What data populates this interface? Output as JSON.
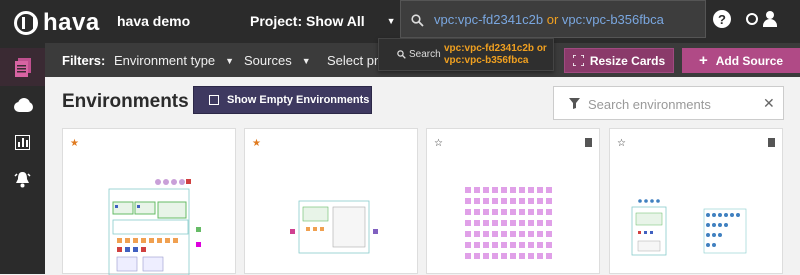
{
  "app": {
    "brand": "hava",
    "workspace": "hava demo",
    "project_label": "Project: Show All",
    "search_query_parts": [
      "vpc:vpc-fd2341c2b",
      " or ",
      "vpc:vpc-b356fbca"
    ],
    "help_label": "?"
  },
  "sidebar": {
    "items": [
      {
        "icon": "documents-icon",
        "active": true
      },
      {
        "icon": "cloud-icon",
        "active": false
      },
      {
        "icon": "bar-chart-icon",
        "active": false
      },
      {
        "icon": "bell-icon",
        "active": false
      }
    ]
  },
  "filters": {
    "label": "Filters:",
    "environment_type": "Environment type",
    "sources": "Sources",
    "select": "Select pro"
  },
  "dropdown": {
    "label": "Search",
    "text": "vpc:vpc-fd2341c2b or vpc:vpc-b356fbca"
  },
  "buttons": {
    "resize": "Resize Cards",
    "add_source": "Add Source",
    "show_empty": "Show Empty Environments"
  },
  "main": {
    "title": "Environments",
    "search_placeholder": "Search environments"
  },
  "colors": {
    "brand_pink": "#b04a86",
    "dark_bg": "#2b2b2b",
    "query_token": "#7aa7e0",
    "query_operator": "#f0a020",
    "purple_button": "#3e3960"
  },
  "cards": [
    {
      "starred": true,
      "deletable": false
    },
    {
      "starred": true,
      "deletable": false
    },
    {
      "starred": false,
      "deletable": true
    },
    {
      "starred": false,
      "deletable": true
    }
  ]
}
